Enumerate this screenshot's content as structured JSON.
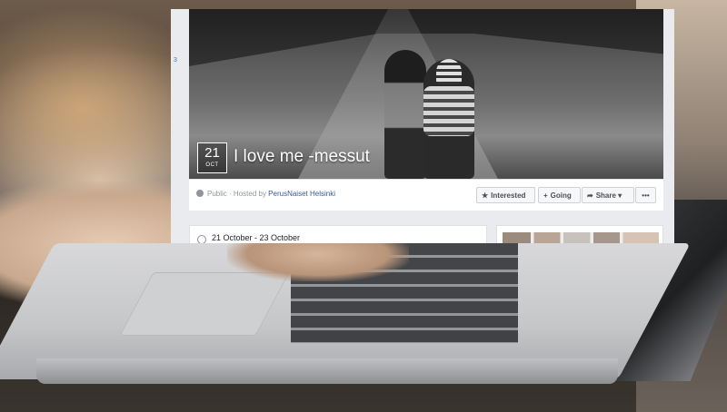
{
  "event": {
    "date_day": "21",
    "date_month": "OCT",
    "title": "I love me -messut",
    "privacy": "Public",
    "hosted_by_prefix": "· Hosted by",
    "host": "PerusNaiset Helsinki",
    "date_range": "21 October - 23 October",
    "marker": "3"
  },
  "actions": {
    "interested": "Interested",
    "going": "Going",
    "share": "Share",
    "more": "•••"
  },
  "icons": {
    "interested": "star-icon",
    "going": "plus-icon",
    "share": "share-arrow-icon",
    "privacy": "globe-icon",
    "date": "clock-icon"
  },
  "colors": {
    "fb_bg": "#e9ebee",
    "link": "#365899",
    "muted": "#90949c"
  }
}
